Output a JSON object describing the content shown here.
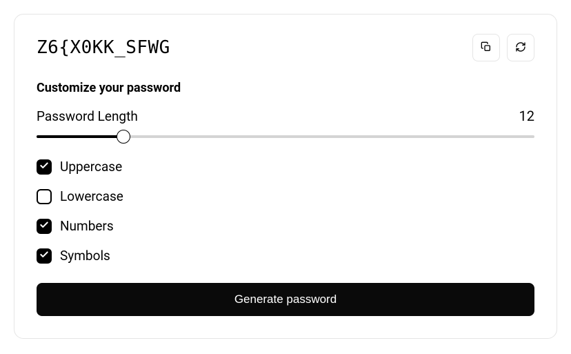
{
  "password": "Z6{X0KK_SFWG",
  "section_title": "Customize your password",
  "length": {
    "label": "Password Length",
    "value": "12"
  },
  "options": {
    "uppercase": {
      "label": "Uppercase",
      "checked": true
    },
    "lowercase": {
      "label": "Lowercase",
      "checked": false
    },
    "numbers": {
      "label": "Numbers",
      "checked": true
    },
    "symbols": {
      "label": "Symbols",
      "checked": true
    }
  },
  "generate_label": "Generate password"
}
